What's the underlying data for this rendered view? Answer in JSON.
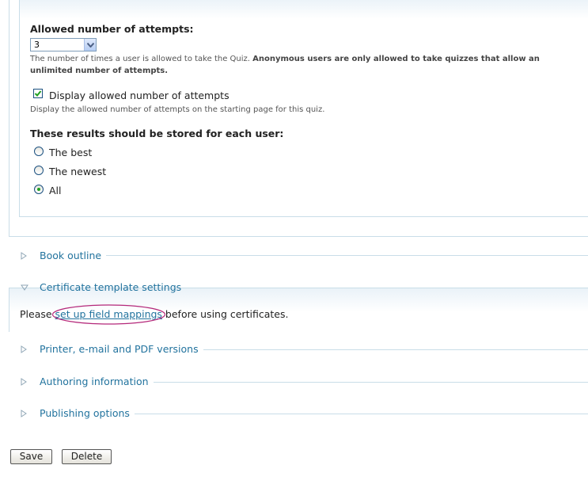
{
  "attempts": {
    "label": "Allowed number of attempts:",
    "selected": "3",
    "description_plain": "The number of times a user is allowed to take the Quiz.",
    "description_bold": "Anonymous users are only allowed to take quizzes that allow an unlimited number of attempts."
  },
  "display_attempts": {
    "checked": true,
    "label": "Display allowed number of attempts",
    "description": "Display the allowed number of attempts on the starting page for this quiz."
  },
  "results": {
    "label": "These results should be stored for each user:",
    "options": [
      {
        "label": "The best",
        "selected": false
      },
      {
        "label": "The newest",
        "selected": false
      },
      {
        "label": "All",
        "selected": true
      }
    ]
  },
  "sections": {
    "book_outline": "Book outline",
    "certificate": "Certificate template settings",
    "printer": "Printer, e-mail and PDF versions",
    "authoring": "Authoring information",
    "publishing": "Publishing options"
  },
  "certificate_message": {
    "before": "Please ",
    "link": "set up field mappings",
    "after": " before using certificates."
  },
  "buttons": {
    "save": "Save",
    "delete": "Delete"
  }
}
